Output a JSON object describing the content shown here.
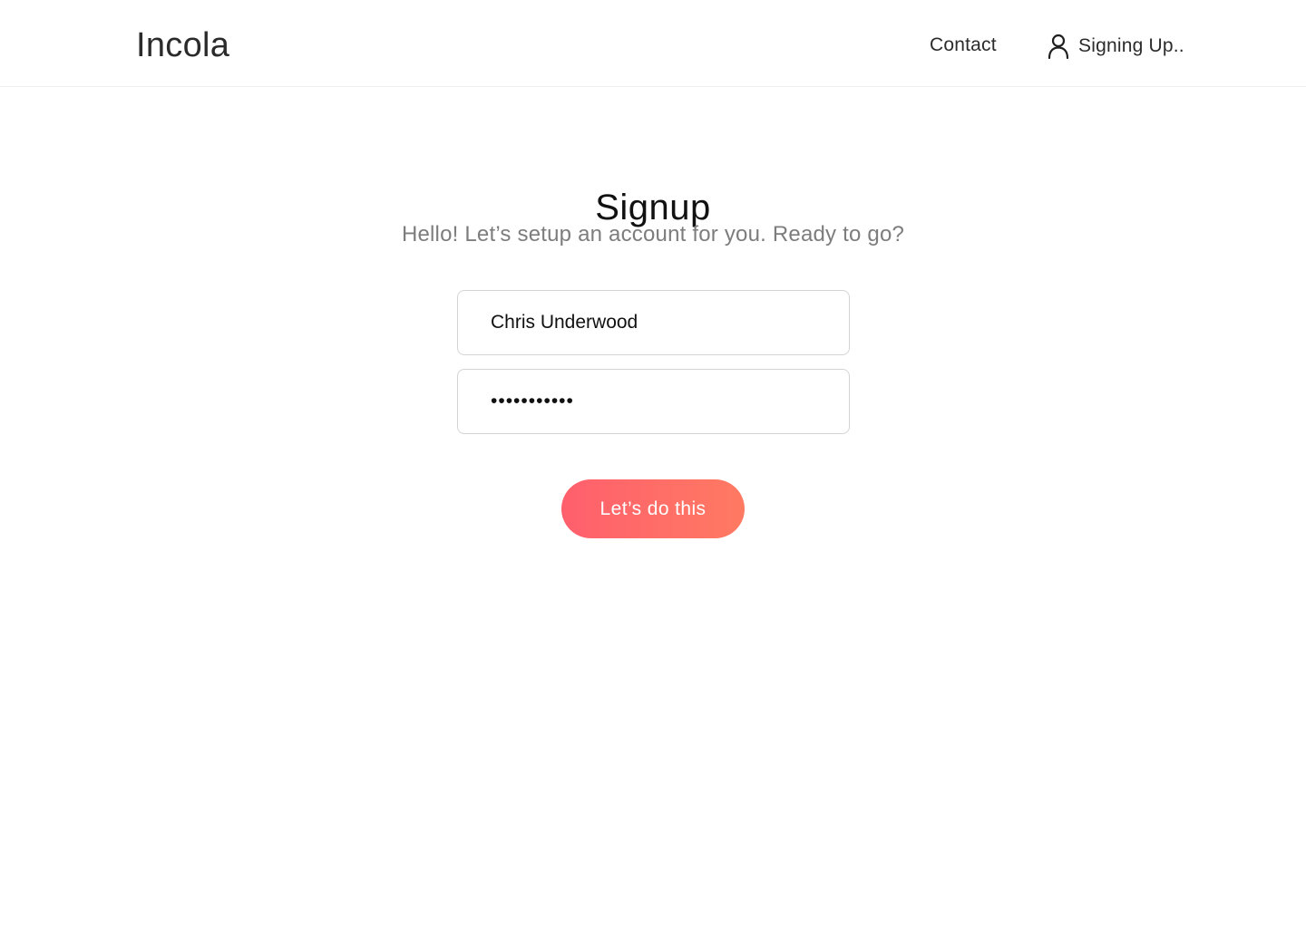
{
  "header": {
    "brand": "Incola",
    "nav_contact": "Contact",
    "user_status": "Signing Up..",
    "user_icon": "user-icon"
  },
  "signup": {
    "title": "Signup",
    "subtitle": "Hello! Let’s setup an account for you. Ready to go?",
    "name_value": "Chris Underwood",
    "password_value": "•••••••••••",
    "submit_label": "Let’s do this"
  },
  "colors": {
    "accent_start": "#ff5f6d",
    "accent_end": "#ff7a62",
    "subtitle_gray": "#7d7d7d",
    "field_border": "#d4d4d4"
  }
}
